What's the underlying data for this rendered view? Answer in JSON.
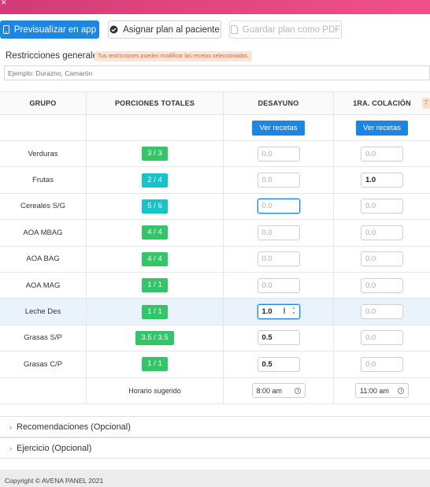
{
  "toolbar": {
    "preview_label": "Previsualizar en app",
    "assign_label": "Asignar plan al paciente",
    "pdf_label": "Guardar plan como PDF"
  },
  "restrictions": {
    "label": "Restricciones generales:",
    "warning": "Tus restricciones pueden modificar las recetas seleccionadas.",
    "placeholder": "Ejemplo: Durazno, Camarón"
  },
  "table": {
    "headers": [
      "GRUPO",
      "PORCIONES TOTALES",
      "DESAYUNO",
      "1RA. COLACIÓN"
    ],
    "colacion_badge": "7",
    "ver_recetas_label": "Ver recetas",
    "rows": [
      {
        "group": "Verduras",
        "portions": "3 / 3",
        "pill": "green",
        "desayuno": "0.0",
        "desayuno_filled": false,
        "colacion": "0.0",
        "colacion_filled": false
      },
      {
        "group": "Frutas",
        "portions": "2 / 4",
        "pill": "teal",
        "desayuno": "0.0",
        "desayuno_filled": false,
        "colacion": "1.0",
        "colacion_filled": true
      },
      {
        "group": "Cereales S/G",
        "portions": "5 / 6",
        "pill": "teal",
        "desayuno": "0.0",
        "desayuno_filled": false,
        "colacion": "0.0",
        "colacion_filled": false
      },
      {
        "group": "AOA MBAG",
        "portions": "4 / 4",
        "pill": "green",
        "desayuno": "0.0",
        "desayuno_filled": false,
        "colacion": "0.0",
        "colacion_filled": false
      },
      {
        "group": "AOA BAG",
        "portions": "4 / 4",
        "pill": "green",
        "desayuno": "0.0",
        "desayuno_filled": false,
        "colacion": "0.0",
        "colacion_filled": false
      },
      {
        "group": "AOA MAG",
        "portions": "1 / 1",
        "pill": "green",
        "desayuno": "0.0",
        "desayuno_filled": false,
        "colacion": "0.0",
        "colacion_filled": false
      },
      {
        "group": "Leche Des",
        "portions": "1 / 1",
        "pill": "green",
        "desayuno": "1.0",
        "desayuno_filled": true,
        "colacion": "0.0",
        "colacion_filled": false
      },
      {
        "group": "Grasas S/P",
        "portions": "3.5 / 3.5",
        "pill": "green",
        "desayuno": "0.5",
        "desayuno_filled": true,
        "colacion": "0.0",
        "colacion_filled": false
      },
      {
        "group": "Grasas C/P",
        "portions": "1 / 1",
        "pill": "green",
        "desayuno": "0.5",
        "desayuno_filled": true,
        "colacion": "0.0",
        "colacion_filled": false
      }
    ],
    "horario_label": "Horario sugerido",
    "desayuno_time": "8:00 am",
    "colacion_time": "11:00 am"
  },
  "accordions": {
    "recomendaciones": "Recomendaciones (Opcional)",
    "ejercicio": "Ejercicio (Opcional)"
  },
  "footer": {
    "copyright": "Copyright © AVENA PANEL 2021"
  },
  "colors": {
    "primary": "#1d86e0",
    "pill_green": "#35c46a",
    "pill_teal": "#17c3c9",
    "topbar": "#e0457c"
  }
}
